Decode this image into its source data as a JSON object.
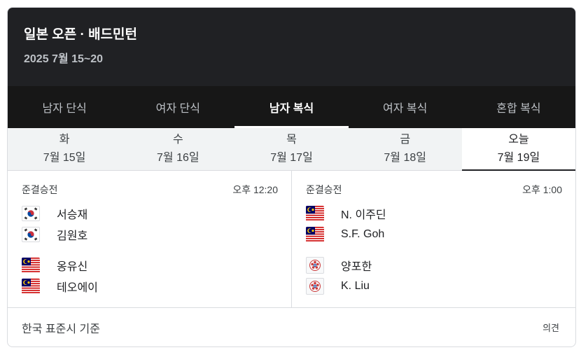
{
  "header": {
    "title": "일본 오픈 · 배드민턴",
    "subtitle": "2025 7월 15~20"
  },
  "tabs": [
    {
      "label": "남자 단식",
      "active": false
    },
    {
      "label": "여자 단식",
      "active": false
    },
    {
      "label": "남자 복식",
      "active": true
    },
    {
      "label": "여자 복식",
      "active": false
    },
    {
      "label": "혼합 복식",
      "active": false
    }
  ],
  "days": [
    {
      "weekday": "화",
      "date": "7월 15일",
      "active": false
    },
    {
      "weekday": "수",
      "date": "7월 16일",
      "active": false
    },
    {
      "weekday": "목",
      "date": "7월 17일",
      "active": false
    },
    {
      "weekday": "금",
      "date": "7월 18일",
      "active": false
    },
    {
      "weekday": "오늘",
      "date": "7월 19일",
      "active": true
    }
  ],
  "matches": [
    {
      "stage": "준결승전",
      "time": "오후 12:20",
      "team1": {
        "flag": "south-korea-flag-icon",
        "players": [
          "서승재",
          "김원호"
        ]
      },
      "team2": {
        "flag": "malaysia-flag-icon",
        "players": [
          "옹유신",
          "테오에이"
        ]
      }
    },
    {
      "stage": "준결승전",
      "time": "오후 1:00",
      "team1": {
        "flag": "malaysia-flag-icon",
        "players": [
          "N. 이주딘",
          "S.F. Goh"
        ]
      },
      "team2": {
        "flag": "chinese-taipei-flag-icon",
        "players": [
          "양포한",
          "K. Liu"
        ]
      }
    }
  ],
  "footer": {
    "timezone_note": "한국 표준시 기준",
    "feedback_label": "의견"
  },
  "colors": {
    "header_bg": "#202124",
    "tabs_bg": "#171717",
    "days_bg": "#f1f3f4",
    "korea_red": "#cd2e3a",
    "korea_blue": "#0047a0",
    "malaysia_red": "#cc0001",
    "malaysia_blue": "#010066",
    "malaysia_yellow": "#ffcc00"
  }
}
